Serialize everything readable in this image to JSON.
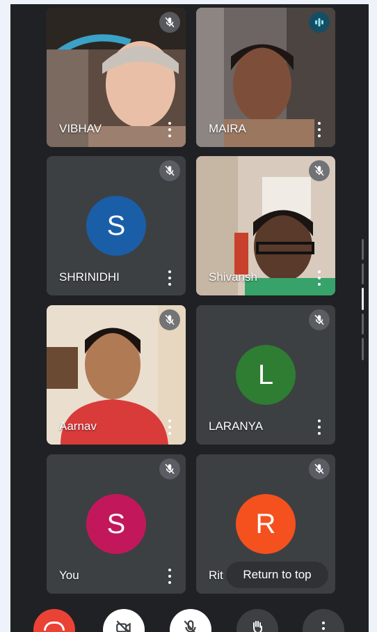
{
  "participants": [
    {
      "name": "VIBHAV",
      "muted": true,
      "type": "video"
    },
    {
      "name": "MAIRA",
      "muted": false,
      "speaking": true,
      "type": "video"
    },
    {
      "name": "SHRINIDHI",
      "muted": true,
      "type": "avatar",
      "initial": "S",
      "avatar_color": "#1a5ea8"
    },
    {
      "name": "Shivansh",
      "muted": true,
      "type": "video"
    },
    {
      "name": "Aarnav",
      "muted": true,
      "type": "video"
    },
    {
      "name": "LARANYA",
      "muted": true,
      "type": "avatar",
      "initial": "L",
      "avatar_color": "#2e7d32"
    },
    {
      "name": "You",
      "muted": true,
      "type": "avatar",
      "initial": "S",
      "avatar_color": "#c2185b"
    },
    {
      "name": "Rit",
      "muted": true,
      "type": "avatar",
      "initial": "R",
      "avatar_color": "#f4511e"
    }
  ],
  "toast": {
    "label": "Return to top"
  },
  "controls": [
    {
      "icon": "end-call-icon",
      "color": "#ea4335"
    },
    {
      "icon": "camera-off-icon",
      "color": "#ffffff"
    },
    {
      "icon": "mic-off-icon",
      "color": "#ffffff"
    },
    {
      "icon": "raise-hand-icon",
      "color": "#3c4043"
    },
    {
      "icon": "more-options-icon",
      "color": "#3c4043"
    }
  ],
  "colors": {
    "background": "#202124",
    "tile": "#3c4043",
    "speaking_border": "#2fb3c4"
  }
}
